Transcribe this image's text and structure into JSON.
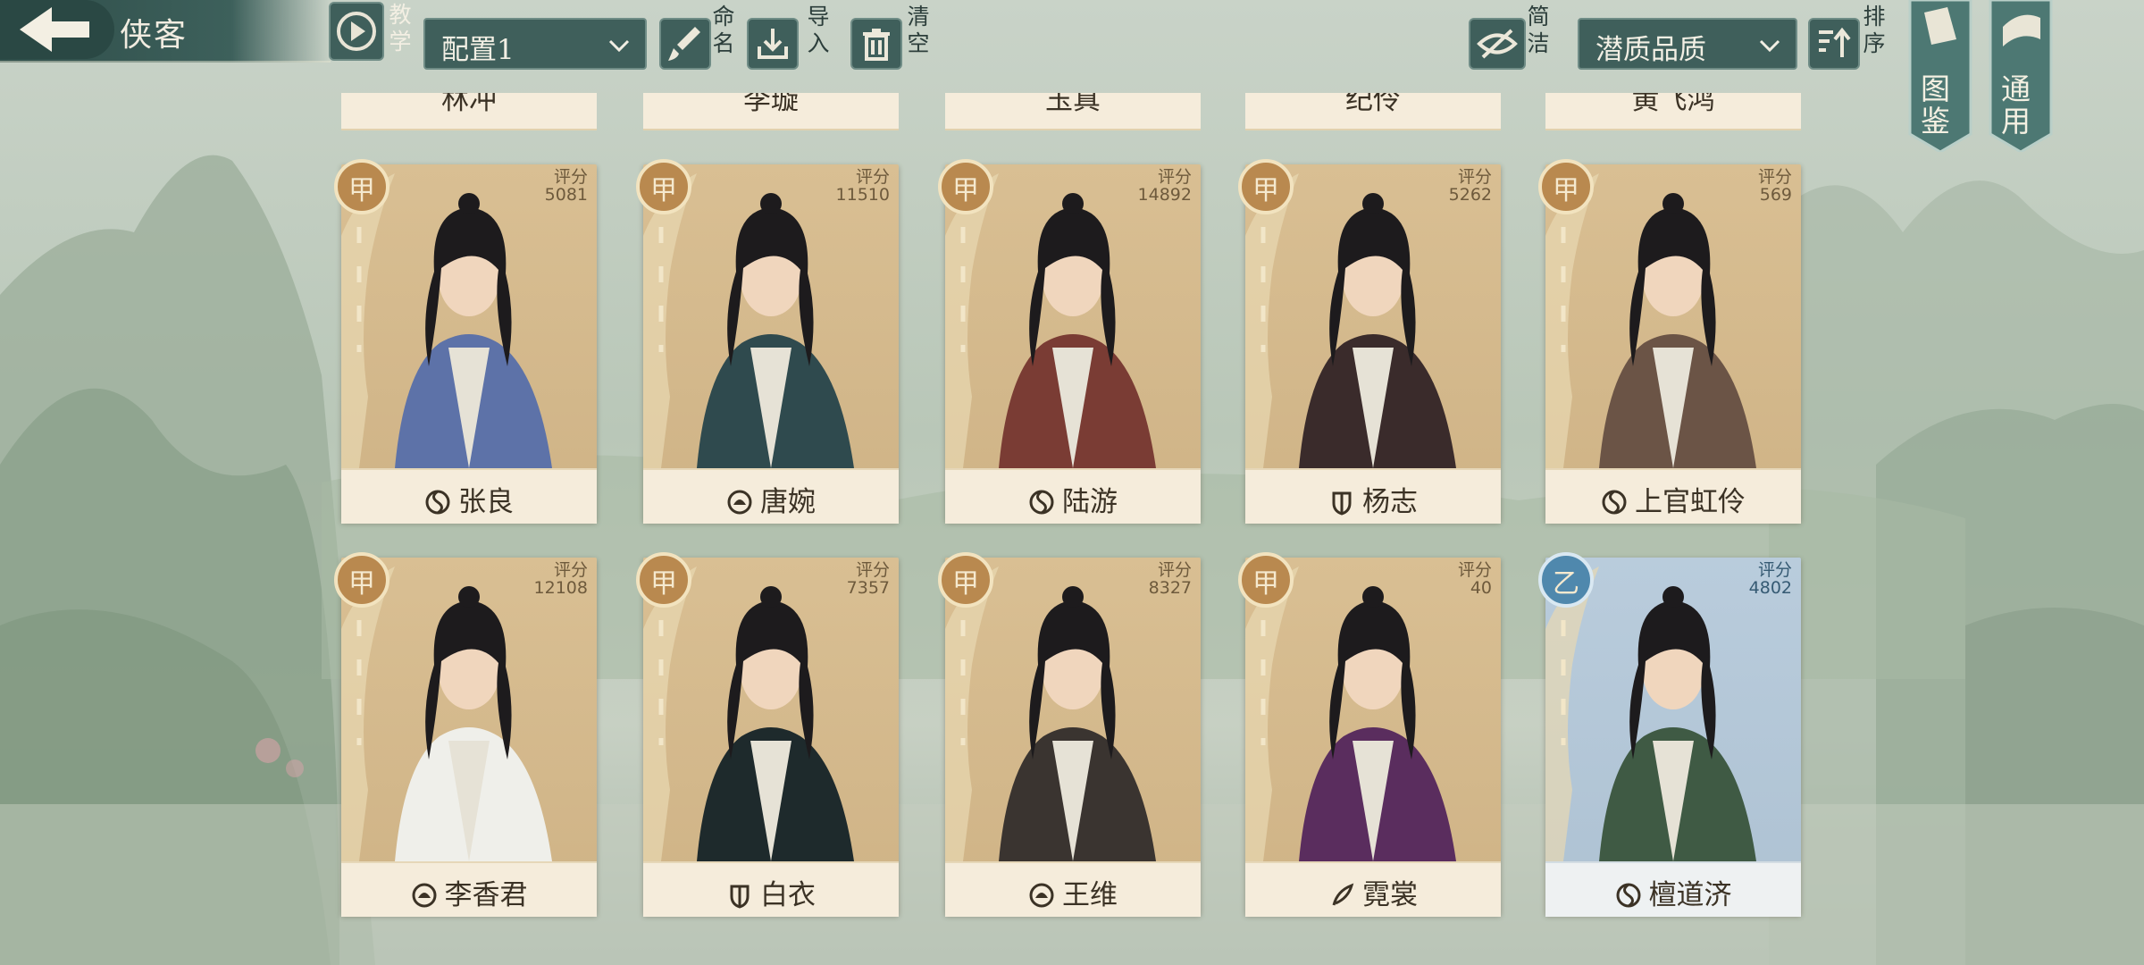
{
  "header": {
    "title": "侠客",
    "tutorial_label": "教学",
    "config_value": "配置1",
    "rename_label": "命名",
    "import_label": "导入",
    "clear_label": "清空",
    "simple_label": "简洁",
    "quality_value": "潜质品质",
    "sort_label": "排序",
    "atlas_label": "图鉴",
    "general_label": "通用"
  },
  "partial_row": [
    "林冲",
    "李璇",
    "玉真",
    "纪伶",
    "黄飞鸿"
  ],
  "score_label": "评分",
  "cards": [
    {
      "name": "张良",
      "grade": "甲",
      "score": "5081",
      "faction": "yinyang-icon",
      "tier": "gold"
    },
    {
      "name": "唐婉",
      "grade": "甲",
      "score": "11510",
      "faction": "lotus-icon",
      "tier": "gold"
    },
    {
      "name": "陆游",
      "grade": "甲",
      "score": "14892",
      "faction": "yinyang-icon",
      "tier": "gold"
    },
    {
      "name": "杨志",
      "grade": "甲",
      "score": "5262",
      "faction": "shield-icon",
      "tier": "gold"
    },
    {
      "name": "上官虹伶",
      "grade": "甲",
      "score": "569",
      "faction": "yinyang-icon",
      "tier": "gold"
    },
    {
      "name": "李香君",
      "grade": "甲",
      "score": "12108",
      "faction": "lotus-icon",
      "tier": "gold"
    },
    {
      "name": "白衣",
      "grade": "甲",
      "score": "7357",
      "faction": "shield-icon",
      "tier": "gold"
    },
    {
      "name": "王维",
      "grade": "甲",
      "score": "8327",
      "faction": "lotus-icon",
      "tier": "gold"
    },
    {
      "name": "霓裳",
      "grade": "甲",
      "score": "40",
      "faction": "feather-icon",
      "tier": "gold"
    },
    {
      "name": "檀道济",
      "grade": "乙",
      "score": "4802",
      "faction": "yinyang-icon",
      "tier": "blue"
    }
  ],
  "colors": {
    "gold_frame": "#d9bf93",
    "blue_frame": "#b9ccdc",
    "bar": "#3f5f5b",
    "ink": "#3b3225"
  }
}
